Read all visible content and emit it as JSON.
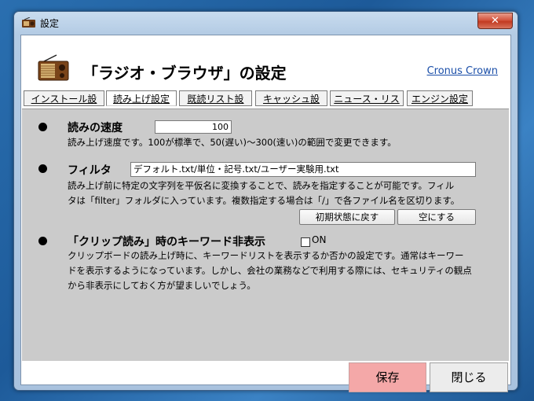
{
  "window": {
    "title": "設定",
    "close_glyph": "✕"
  },
  "header": {
    "title": "「ラジオ・ブラウザ」の設定",
    "link": "Cronus Crown"
  },
  "tabs": [
    {
      "label": "インストール設定"
    },
    {
      "label": "読み上げ設定"
    },
    {
      "label": "既読リスト設定"
    },
    {
      "label": "キャッシュ設定"
    },
    {
      "label": "ニュース・リスト"
    },
    {
      "label": "エンジン設定"
    }
  ],
  "speed": {
    "label": "読みの速度",
    "value": "100",
    "desc": "読み上げ速度です。100が標準で、50(遅い)〜300(速い)の範囲で変更できます。"
  },
  "filter": {
    "label": "フィルタ",
    "value": "デフォルト.txt/単位・記号.txt/ユーザー実験用.txt",
    "desc_line1": "読み上げ前に特定の文字列を平仮名に変換することで、読みを指定することが可能です。フィル",
    "desc_line2": "タは「filter」フォルダに入っています。複数指定する場合は「/」で各ファイル名を区切ります。",
    "reset_button": "初期状態に戻す",
    "clear_button": "空にする"
  },
  "clip": {
    "label": "「クリップ読み」時のキーワード非表示",
    "checkbox_label": "ON",
    "checked": false,
    "desc_line1": "クリップボードの読み上げ時に、キーワードリストを表示するか否かの設定です。通常はキーワー",
    "desc_line2": "ドを表示するようになっています。しかし、会社の業務などで利用する際には、セキュリティの観点",
    "desc_line3": "から非表示にしておく方が望ましいでしょう。"
  },
  "footer": {
    "save": "保存",
    "close": "閉じる"
  }
}
